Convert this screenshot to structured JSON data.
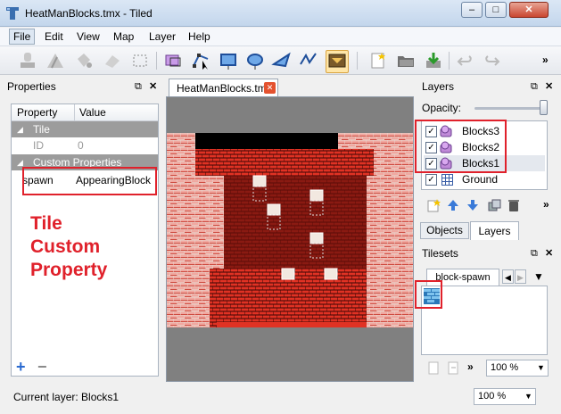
{
  "window": {
    "title": "HeatManBlocks.tmx - Tiled",
    "minimize": "–",
    "maximize": "□",
    "close": "✕"
  },
  "menu": [
    "File",
    "Edit",
    "View",
    "Map",
    "Layer",
    "Help"
  ],
  "toolbar": {
    "overflow": "»"
  },
  "properties_panel": {
    "title": "Properties",
    "col_property": "Property",
    "col_value": "Value",
    "groups": [
      {
        "name": "Tile",
        "rows": [
          {
            "property": "ID",
            "value": "0"
          }
        ]
      },
      {
        "name": "Custom Properties",
        "rows": [
          {
            "property": "spawn",
            "value": "AppearingBlock"
          }
        ]
      }
    ],
    "add_icon": "+",
    "remove_icon": "−"
  },
  "annotation": {
    "text_line1": "Tile",
    "text_line2": "Custom",
    "text_line3": "Property",
    "color": "#e0212b"
  },
  "document": {
    "tab_label": "HeatManBlocks.tmx",
    "tab_close": "✕"
  },
  "layers_panel": {
    "title": "Layers",
    "opacity_label": "Opacity:",
    "layers": [
      {
        "name": "Blocks3",
        "type": "object",
        "checked": true
      },
      {
        "name": "Blocks2",
        "type": "object",
        "checked": true
      },
      {
        "name": "Blocks1",
        "type": "object",
        "checked": true,
        "selected": true
      },
      {
        "name": "Ground",
        "type": "tile",
        "checked": true
      }
    ],
    "tabs": [
      "Objects",
      "Layers"
    ],
    "active_tab": "Layers"
  },
  "tilesets_panel": {
    "title": "Tilesets",
    "tab_label": "block-spawn",
    "zoom": "100 %"
  },
  "status": {
    "current_layer": "Current layer: Blocks1",
    "zoom": "100 %"
  },
  "colors": {
    "brick_light": "#f0a8a0",
    "brick_red": "#c8281c",
    "brick_dark": "#7a1410",
    "mortar": "#e8e0d8"
  }
}
